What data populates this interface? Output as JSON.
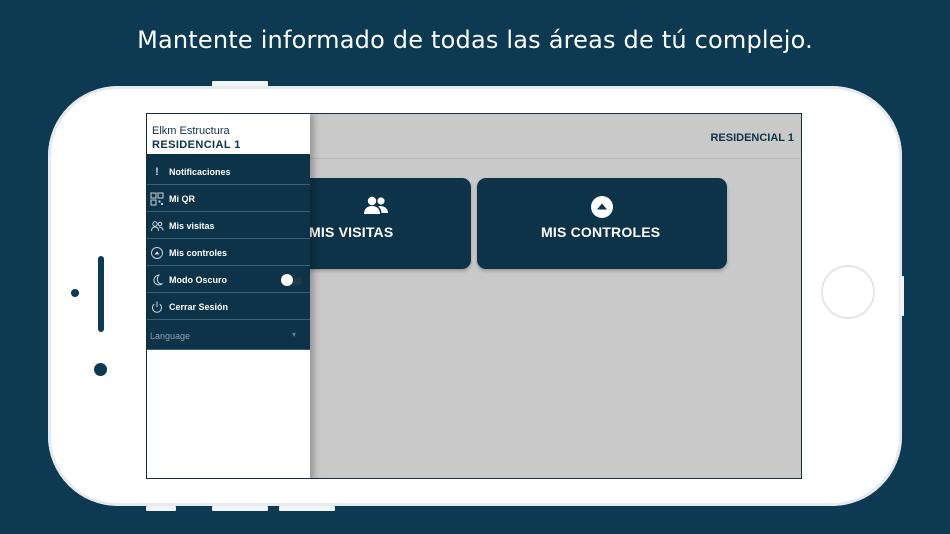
{
  "headline": "Mantente informado de todas las áreas de tú complejo.",
  "colors": {
    "background": "#0b3a52",
    "primary": "#0c3347",
    "screen_bg": "#c9c9c9",
    "text_light": "#ffffff"
  },
  "appbar": {
    "title": "RESIDENCIAL 1"
  },
  "cards": [
    {
      "label": "MIS VISITAS",
      "icon": "people-icon"
    },
    {
      "label": "MIS CONTROLES",
      "icon": "circle-arrow-up-icon"
    }
  ],
  "drawer": {
    "header_line1": "Elkm Estructura",
    "header_line2": "RESIDENCIAL 1",
    "items": [
      {
        "label": "Notificaciones",
        "icon": "exclamation-icon"
      },
      {
        "label": "Mi QR",
        "icon": "qr-code-icon"
      },
      {
        "label": "Mis visitas",
        "icon": "people-icon"
      },
      {
        "label": "Mis controles",
        "icon": "circle-arrow-up-icon"
      },
      {
        "label": "Modo Oscuro",
        "icon": "moon-icon",
        "toggle": false
      },
      {
        "label": "Cerrar Sesión",
        "icon": "power-icon"
      }
    ],
    "language_label": "Language",
    "language_caret": "▾"
  }
}
